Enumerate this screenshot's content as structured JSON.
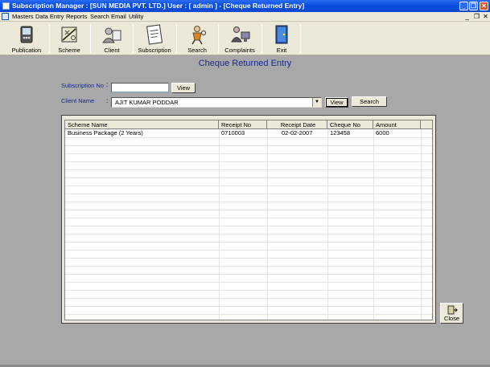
{
  "window": {
    "title": "Subscription Manager : [SUN MEDIA PVT. LTD.] User : [ admin ] - [Cheque Returned Entry]",
    "minimize": "_",
    "restore": "❐",
    "close": "✕"
  },
  "menu": {
    "items": [
      "Masters",
      "Data Entry",
      "Reports",
      "Search",
      "Email",
      "Utility"
    ],
    "mdi_min": "_",
    "mdi_restore": "❐",
    "mdi_close": "✕"
  },
  "toolbar": {
    "buttons": [
      {
        "label": "Publication",
        "icon": "publication-icon"
      },
      {
        "label": "Scheme",
        "icon": "scheme-icon"
      },
      {
        "label": "Client",
        "icon": "client-icon"
      },
      {
        "label": "Subscription",
        "icon": "subscription-icon"
      },
      {
        "label": "Search",
        "icon": "search-icon"
      },
      {
        "label": "Complaints",
        "icon": "complaints-icon"
      },
      {
        "label": "Exit",
        "icon": "exit-icon"
      }
    ]
  },
  "form": {
    "title": "Cheque  Returned Entry",
    "subscription_label": "Subscription No",
    "subscription_colon": ":",
    "subscription_value": "",
    "view_label": "View",
    "client_label": "Client Name",
    "client_colon": ":",
    "client_value": "AJIT KUMAR PODDAR",
    "client_view_label": "View",
    "search_label": "Search"
  },
  "grid": {
    "columns": [
      "Scheme Name",
      "Receipt No",
      "Receipt Date",
      "Cheque No",
      "Amount"
    ],
    "rows": [
      [
        "Business Package (2 Years)",
        "0710003",
        "02-02-2007",
        "123458",
        "6000"
      ]
    ]
  },
  "close_button": {
    "label": "Close",
    "icon": "close-door-icon"
  }
}
